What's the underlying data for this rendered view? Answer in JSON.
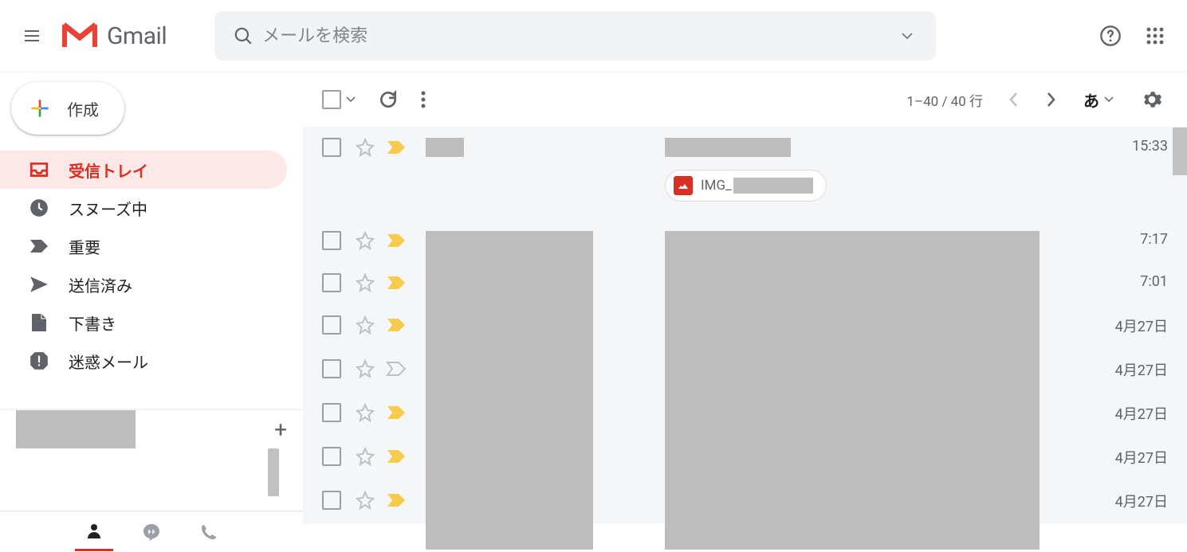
{
  "header": {
    "app_name": "Gmail",
    "search_placeholder": "メールを検索"
  },
  "compose": {
    "label": "作成"
  },
  "sidebar": {
    "items": [
      {
        "id": "inbox",
        "label": "受信トレイ",
        "icon": "inbox"
      },
      {
        "id": "snoozed",
        "label": "スヌーズ中",
        "icon": "clock"
      },
      {
        "id": "important",
        "label": "重要",
        "icon": "important"
      },
      {
        "id": "sent",
        "label": "送信済み",
        "icon": "sent"
      },
      {
        "id": "drafts",
        "label": "下書き",
        "icon": "draft"
      },
      {
        "id": "spam",
        "label": "迷惑メール",
        "icon": "spam"
      }
    ]
  },
  "toolbar": {
    "pager_text": "1–40 / 40 行",
    "lang_label": "あ"
  },
  "mails": [
    {
      "date": "15:33",
      "important": true,
      "attachment_prefix": "IMG_"
    },
    {
      "date": "7:17",
      "important": true
    },
    {
      "date": "7:01",
      "important": true
    },
    {
      "date": "4月27日",
      "important": true
    },
    {
      "date": "4月27日",
      "important": false
    },
    {
      "date": "4月27日",
      "important": true
    },
    {
      "date": "4月27日",
      "important": true
    },
    {
      "date": "4月27日",
      "important": true
    }
  ]
}
